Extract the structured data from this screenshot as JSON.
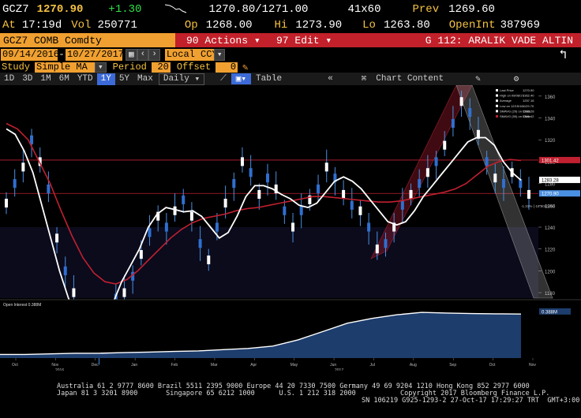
{
  "quote": {
    "ticker": "GCZ7",
    "last": "1270.90",
    "change": "+1.30",
    "bid_ask": "1270.80/1271.00",
    "size": "41x60",
    "prev_label": "Prev",
    "prev": "1269.60",
    "at_label": "At",
    "time": "17:19d",
    "vol_label": "Vol",
    "vol": "250771",
    "op_label": "Op",
    "op": "1268.00",
    "hi_label": "Hi",
    "hi": "1273.90",
    "lo_label": "Lo",
    "lo": "1263.80",
    "oi_label": "OpenInt",
    "oi": "387969"
  },
  "toolbar": {
    "security": "GCZ7 COMB Comdty",
    "actions": "90 Actions ▾",
    "edit": "97 Edit ▾",
    "name": "G 112: ARALIK VADE ALTIN",
    "start_date": "09/14/2016",
    "end_date": "10/27/2017",
    "currency": "Local CCY",
    "study_label": "Study",
    "study_value": "Simple MA",
    "period_label": "Period",
    "period_value": "20",
    "offset_label": "Offset",
    "offset_value": "0",
    "periods": [
      "1D",
      "3D",
      "1M",
      "6M",
      "YTD",
      "1Y",
      "5Y",
      "Max"
    ],
    "selected_period": "1Y",
    "frequency": "Daily",
    "table_label": "Table",
    "chart_content_label": "Chart Content"
  },
  "legend": {
    "items": [
      "Last Price",
      "High on 09/08/17",
      "Average",
      "Low on 12/15/16",
      "SMAVG (20) on Close",
      "SMAVG (50) on Close"
    ],
    "values": [
      "1270.90",
      "1362.40",
      "1257.16",
      "1129.70",
      "1283.28",
      "1301.42"
    ],
    "oi_label": "Open Interest 0.388M",
    "oi_axis_label": "0.388M",
    "change_note": "-1.31% (-16.60Lbs%)"
  },
  "chart_data": {
    "type": "line",
    "x_labels": [
      "Oct",
      "Nov",
      "Dec",
      "Jan",
      "Feb",
      "Mar",
      "Apr",
      "May",
      "Jun",
      "Jul",
      "Aug",
      "Sep",
      "Oct",
      "Nov"
    ],
    "year_labels": [
      "2016",
      "2017"
    ],
    "y_ticks": [
      1180,
      1200,
      1220,
      1240,
      1260,
      1280,
      1300,
      1320,
      1340,
      1360
    ],
    "ylim": [
      1175,
      1370
    ],
    "right_labels": [
      "1301.42",
      "1283.28",
      "1270.90"
    ],
    "series": [
      {
        "name": "Last Price",
        "color": "#4a90e2",
        "values": [
          1262,
          1280,
          1295,
          1320,
          1300,
          1275,
          1230,
          1200,
          1180,
          1160,
          1145,
          1130,
          1150,
          1175,
          1180,
          1195,
          1215,
          1235,
          1250,
          1240,
          1255,
          1265,
          1250,
          1225,
          1210,
          1240,
          1262,
          1280,
          1300,
          1290,
          1270,
          1285,
          1275,
          1255,
          1240,
          1255,
          1265,
          1275,
          1295,
          1285,
          1270,
          1260,
          1255,
          1240,
          1220,
          1225,
          1240,
          1260,
          1270,
          1280,
          1290,
          1300,
          1315,
          1335,
          1355,
          1345,
          1325,
          1300,
          1285,
          1280,
          1290,
          1280,
          1270
        ]
      },
      {
        "name": "SMAVG (20) on Close",
        "color": "#ffffff",
        "values": [
          1330,
          1325,
          1310,
          1290,
          1260,
          1230,
          1200,
          1175,
          1155,
          1140,
          1140,
          1150,
          1170,
          1190,
          1205,
          1220,
          1240,
          1252,
          1258,
          1256,
          1254,
          1255,
          1250,
          1240,
          1230,
          1235,
          1250,
          1268,
          1278,
          1278,
          1275,
          1270,
          1266,
          1260,
          1258,
          1262,
          1272,
          1282,
          1286,
          1282,
          1275,
          1265,
          1255,
          1245,
          1242,
          1245,
          1255,
          1268,
          1278,
          1288,
          1298,
          1308,
          1318,
          1322,
          1322,
          1315,
          1300,
          1290,
          1283
        ]
      },
      {
        "name": "SMAVG (50) on Close",
        "color": "#c02030",
        "values": [
          1335,
          1330,
          1320,
          1300,
          1280,
          1255,
          1232,
          1212,
          1198,
          1190,
          1188,
          1192,
          1200,
          1210,
          1220,
          1230,
          1238,
          1244,
          1248,
          1250,
          1252,
          1255,
          1257,
          1258,
          1260,
          1262,
          1264,
          1266,
          1268,
          1268,
          1267,
          1266,
          1265,
          1264,
          1263,
          1263,
          1264,
          1266,
          1268,
          1270,
          1272,
          1275,
          1280,
          1288,
          1296,
          1300,
          1302,
          1301
        ]
      },
      {
        "name": "Open Interest",
        "color": "#ffffff",
        "values": [
          0.03,
          0.03,
          0.035,
          0.04,
          0.04,
          0.045,
          0.05,
          0.055,
          0.06,
          0.07,
          0.08,
          0.1,
          0.15,
          0.22,
          0.29,
          0.33,
          0.36,
          0.38,
          0.375,
          0.37,
          0.368,
          0.366
        ]
      }
    ]
  },
  "footer": {
    "line1": "Australia 61 2 9777 8600 Brazil 5511 2395 9000 Europe 44 20 7330 7500 Germany 49 69 9204 1210 Hong Kong 852 2977 6000",
    "line2": "Japan 81 3 3201 8900       Singapore 65 6212 1000      U.S. 1 212 318 2000           Copyright 2017 Bloomberg Finance L.P.",
    "line3": "SN 106219 G925-1293-2 27-Oct-17 17:29:27 TRT  GMT+3:00"
  }
}
